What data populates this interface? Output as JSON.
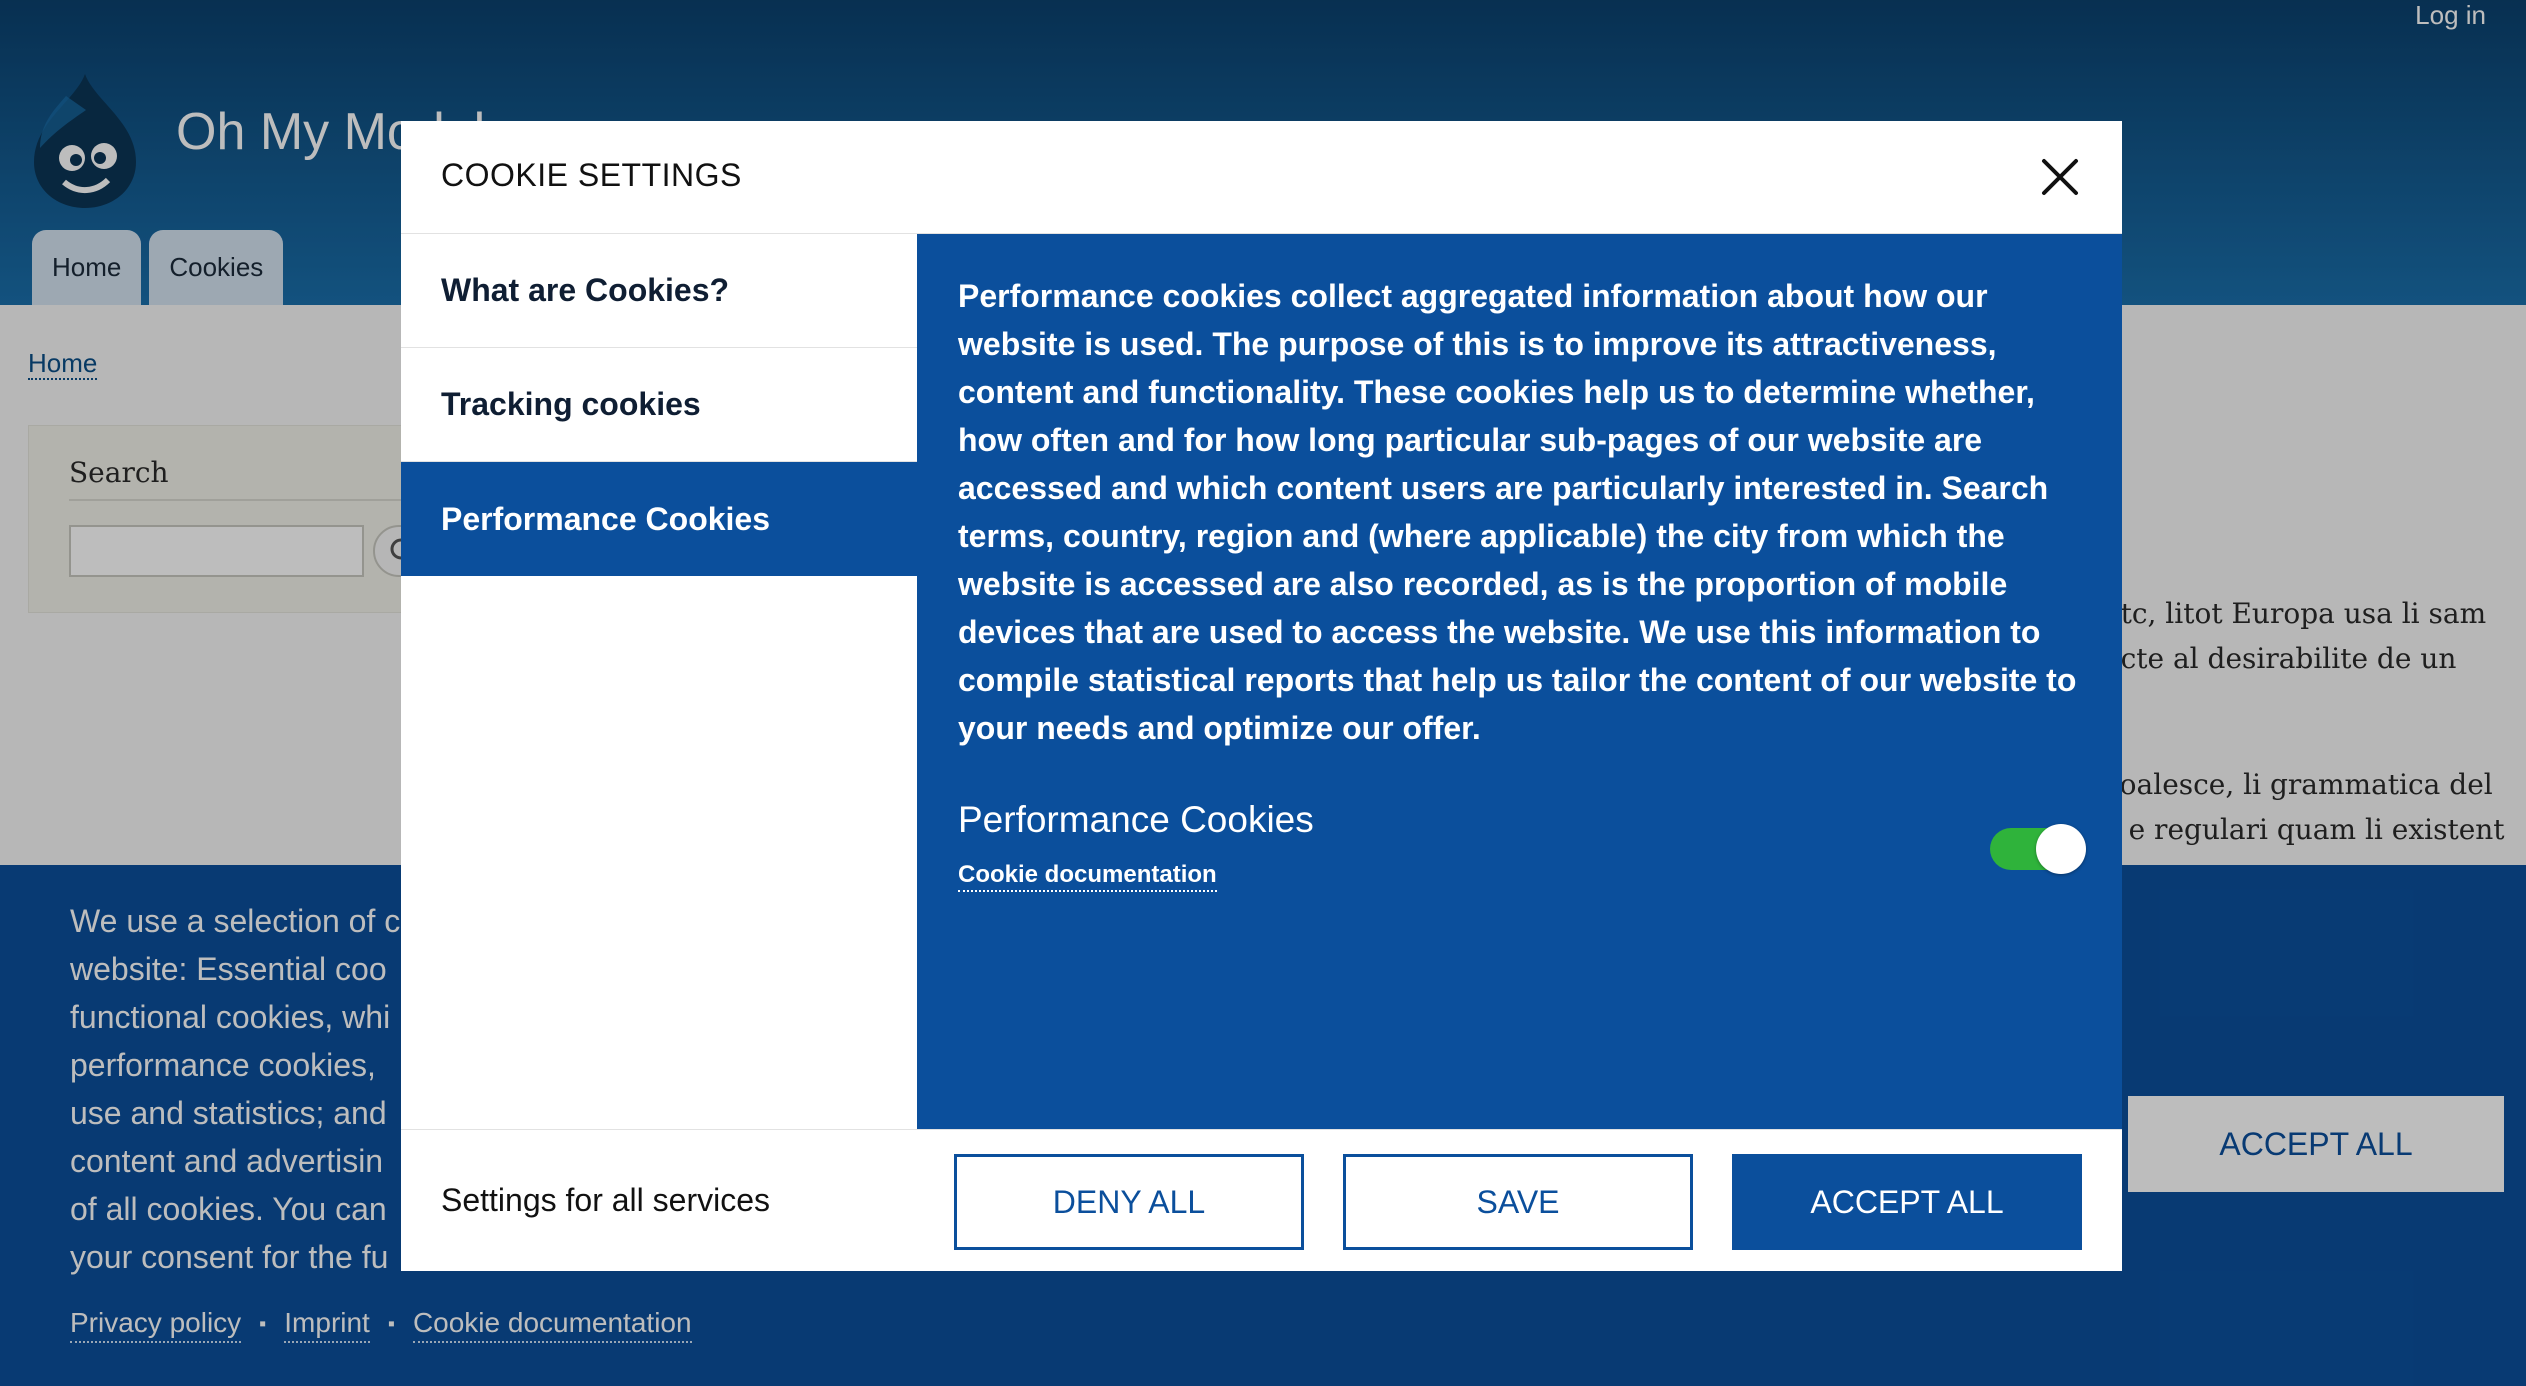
{
  "header": {
    "login_label": "Log in",
    "site_name": "Oh My Module",
    "tabs": [
      {
        "label": "Home"
      },
      {
        "label": "Cookies"
      }
    ]
  },
  "breadcrumb": {
    "home_label": "Home"
  },
  "search": {
    "title": "Search",
    "placeholder": ""
  },
  "body_text": {
    "p1_line1": "etc, litot Europa usa li sam",
    "p1_line2": "ecte al desirabilite de un",
    "p2_line1": "coalesce, li grammatica del",
    "p2_line2": "c e regulari quam li existent"
  },
  "banner": {
    "text": "We use a selection of c\nwebsite: Essential coo\nfunctional cookies, whi\nperformance cookies, \nuse and statistics; and\ncontent and advertisin\nof all cookies. You can\nyour consent for the fu",
    "links": [
      {
        "label": "Privacy policy"
      },
      {
        "label": "Imprint"
      },
      {
        "label": "Cookie documentation"
      }
    ],
    "separator": "▪",
    "accept_all_label": "ACCEPT ALL"
  },
  "modal": {
    "title": "COOKIE SETTINGS",
    "nav": [
      {
        "label": "What are Cookies?"
      },
      {
        "label": "Tracking cookies"
      },
      {
        "label": "Performance Cookies"
      }
    ],
    "active_nav_index": 2,
    "panel": {
      "description": "Performance cookies collect aggregated information about how our website is used. The purpose of this is to improve its attractiveness, content and functionality. These cookies help us to determine whether, how often and for how long particular sub-pages of our website are accessed and which content users are particularly interested in. Search terms, country, region and (where applicable) the city from which the website is accessed are also recorded, as is the proportion of mobile devices that are used to access the website. We use this information to compile statistical reports that help us tailor the content of our website to your needs and optimize our offer.",
      "service_name": "Performance Cookies",
      "service_doc_label": "Cookie documentation",
      "toggle_on": true
    },
    "footer": {
      "label": "Settings for all services",
      "deny_label": "DENY ALL",
      "save_label": "SAVE",
      "accept_label": "ACCEPT ALL"
    }
  },
  "colors": {
    "primary_blue": "#0b4f9c",
    "toggle_green": "#2fb33b",
    "header_dark": "#0b416e",
    "header_light": "#1a6fab"
  },
  "icons": {
    "close": "close-icon",
    "logo": "drupal-logo-icon",
    "search": "search-icon"
  }
}
